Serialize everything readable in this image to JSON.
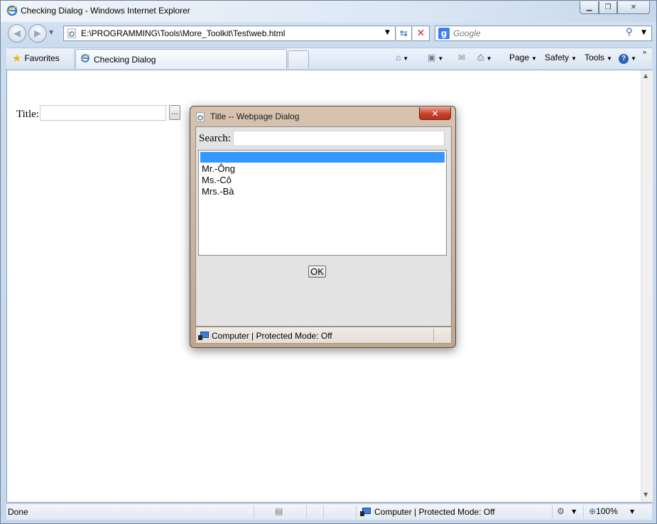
{
  "window": {
    "title": "Checking Dialog - Windows Internet Explorer",
    "min": "▁",
    "max": "❐",
    "close": "✕"
  },
  "nav": {
    "address": "E:\\PROGRAMMING\\Tools\\More_Toolkit\\Test\\web.html",
    "search_placeholder": "Google",
    "search_engine_icon": "g-icon"
  },
  "toolbar": {
    "favorites": "Favorites",
    "tab_title": "Checking Dialog",
    "page": "Page",
    "safety": "Safety",
    "tools": "Tools",
    "help": "?"
  },
  "page": {
    "title_label": "Title:",
    "title_value": "",
    "browse_label": "..."
  },
  "status": {
    "text": "Done",
    "zone": "Computer | Protected Mode: Off",
    "zoom": "100%"
  },
  "dialog": {
    "title": "Title -- Webpage Dialog",
    "close": "✕",
    "search_label": "Search:",
    "search_value": "",
    "options": [
      "",
      "Mr.-Ông",
      "Ms.-Cô",
      "Mrs.-Bà"
    ],
    "selected_index": 0,
    "ok_label": "OK",
    "status_zone": "Computer | Protected Mode: Off"
  },
  "colors": {
    "selection": "#3399ff",
    "dialog_frame": "#c9b29d",
    "close_red": "#c9412b"
  }
}
